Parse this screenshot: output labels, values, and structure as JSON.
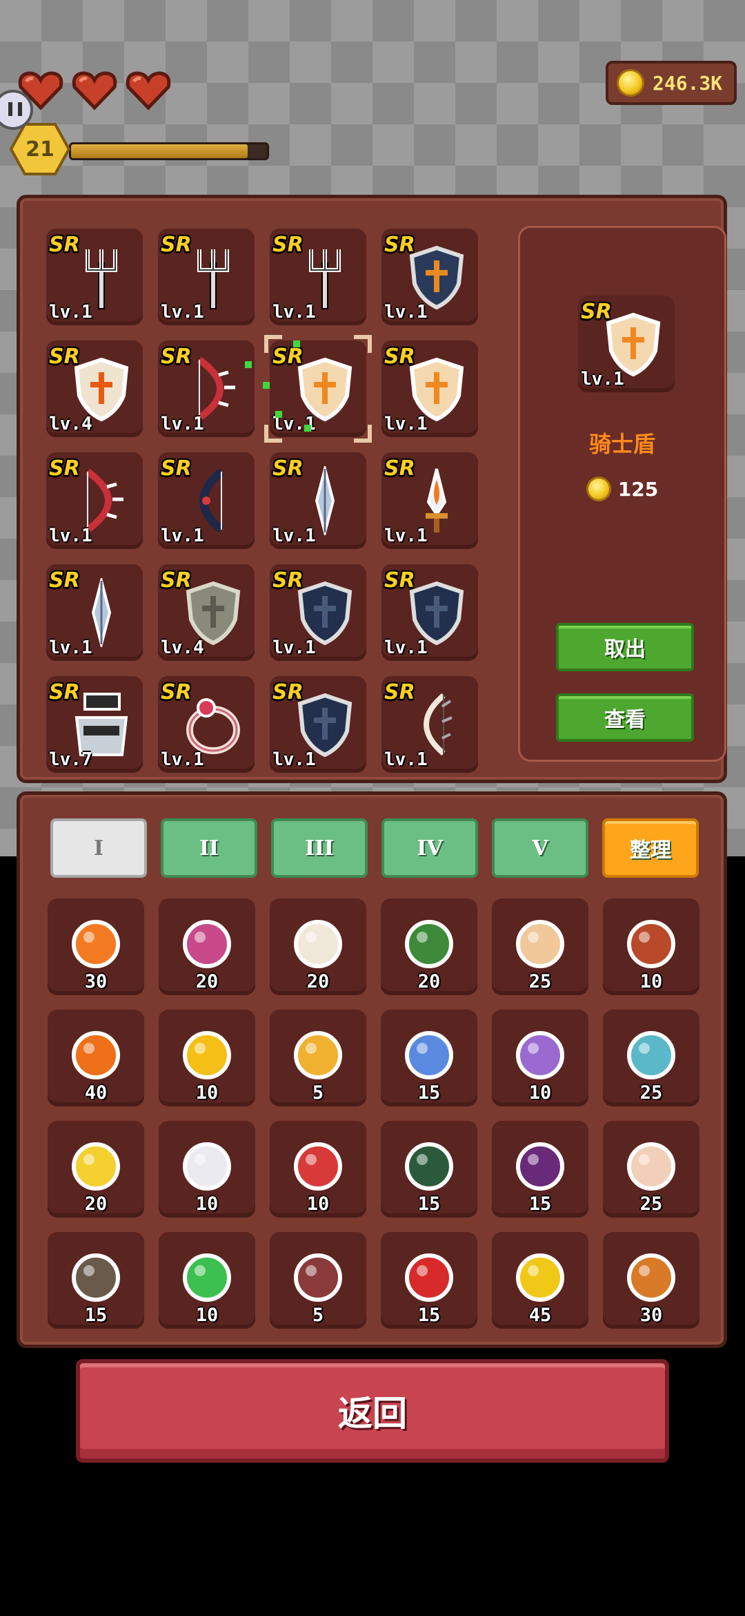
{
  "hud": {
    "hearts": 3,
    "player_level": "21",
    "xp_fraction": 0.9,
    "gold": "246.3K"
  },
  "equipment": {
    "rarity_label": "SR",
    "slots": [
      {
        "icon": "trident-icon",
        "level": "lv.1"
      },
      {
        "icon": "trident-icon",
        "level": "lv.1"
      },
      {
        "icon": "trident-icon",
        "level": "lv.1"
      },
      {
        "icon": "dark-shield-icon",
        "level": "lv.1"
      },
      {
        "icon": "fire-shield-icon",
        "level": "lv.4"
      },
      {
        "icon": "spiked-bow-icon",
        "level": "lv.1"
      },
      {
        "icon": "knight-shield-icon",
        "level": "lv.1",
        "selected": true
      },
      {
        "icon": "knight-shield-icon",
        "level": "lv.1"
      },
      {
        "icon": "spiked-bow-icon",
        "level": "lv.1"
      },
      {
        "icon": "dark-bow-icon",
        "level": "lv.1"
      },
      {
        "icon": "spear-icon",
        "level": "lv.1"
      },
      {
        "icon": "flame-sword-icon",
        "level": "lv.1"
      },
      {
        "icon": "spear-icon",
        "level": "lv.1"
      },
      {
        "icon": "stone-shield-icon",
        "level": "lv.4"
      },
      {
        "icon": "navy-shield-icon",
        "level": "lv.1"
      },
      {
        "icon": "navy-shield-icon",
        "level": "lv.1"
      },
      {
        "icon": "armor-icon",
        "level": "lv.7"
      },
      {
        "icon": "ring-icon",
        "level": "lv.1"
      },
      {
        "icon": "navy-shield-icon",
        "level": "lv.1"
      },
      {
        "icon": "bone-bow-icon",
        "level": "lv.1"
      }
    ]
  },
  "detail": {
    "level": "lv.1",
    "name": "骑士盾",
    "price": "125",
    "take_out_label": "取出",
    "view_label": "查看"
  },
  "tabs": [
    {
      "label": "I",
      "active": true
    },
    {
      "label": "II"
    },
    {
      "label": "III"
    },
    {
      "label": "IV"
    },
    {
      "label": "V"
    }
  ],
  "sort_label": "整理",
  "inventory": [
    {
      "icon": "carrot-icon",
      "color": "#f47a22",
      "count": "30"
    },
    {
      "icon": "rose-icon",
      "color": "#c84a8a",
      "count": "20"
    },
    {
      "icon": "cauliflower-icon",
      "color": "#f0e8d8",
      "count": "20"
    },
    {
      "icon": "broccoli-icon",
      "color": "#3c8a3a",
      "count": "20"
    },
    {
      "icon": "parsnip-icon",
      "color": "#f0c89a",
      "count": "25"
    },
    {
      "icon": "meat-icon",
      "color": "#b84a2a",
      "count": "10"
    },
    {
      "icon": "pumpkin-icon",
      "color": "#ee7018",
      "count": "40"
    },
    {
      "icon": "sunflower-icon",
      "color": "#f4c018",
      "count": "10"
    },
    {
      "icon": "wheat-icon",
      "color": "#f0b030",
      "count": "5"
    },
    {
      "icon": "blue-jar-icon",
      "color": "#5a8ae0",
      "count": "15"
    },
    {
      "icon": "grapes-icon",
      "color": "#9a6ad0",
      "count": "10"
    },
    {
      "icon": "starfish-icon",
      "color": "#5ab8c8",
      "count": "25"
    },
    {
      "icon": "corn-icon",
      "color": "#f4d030",
      "count": "20"
    },
    {
      "icon": "garlic-icon",
      "color": "#eaeaf0",
      "count": "10"
    },
    {
      "icon": "strawberry-icon",
      "color": "#d83a3a",
      "count": "10"
    },
    {
      "icon": "melon-icon",
      "color": "#2a5a3a",
      "count": "15"
    },
    {
      "icon": "eggplant-icon",
      "color": "#6a2a7a",
      "count": "15"
    },
    {
      "icon": "egg-icon",
      "color": "#f2cfb8",
      "count": "25"
    },
    {
      "icon": "wing-icon",
      "color": "#6a5a4a",
      "count": "15"
    },
    {
      "icon": "slime-icon",
      "color": "#3cc050",
      "count": "10"
    },
    {
      "icon": "honey-jar-icon",
      "color": "#8a3a3a",
      "count": "5"
    },
    {
      "icon": "mushroom-icon",
      "color": "#d82a2a",
      "count": "15"
    },
    {
      "icon": "cheese-icon",
      "color": "#f0c818",
      "count": "45"
    },
    {
      "icon": "pretzel-icon",
      "color": "#d87a28",
      "count": "30"
    }
  ],
  "back_label": "返回"
}
